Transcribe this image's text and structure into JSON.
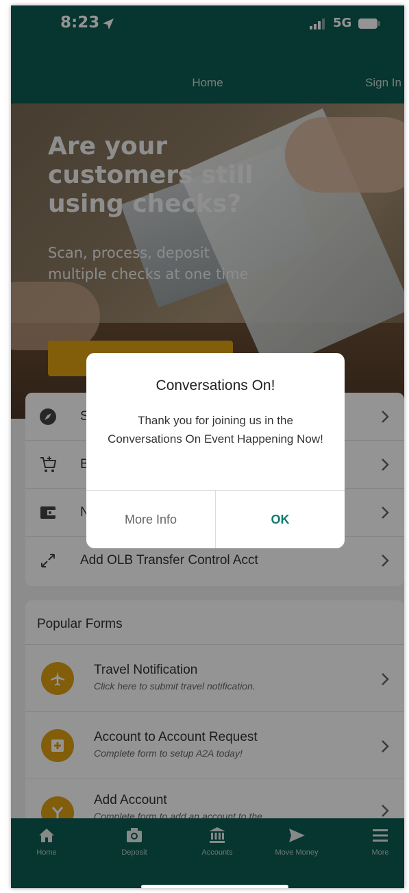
{
  "status_bar": {
    "time": "8:23",
    "network": "5G"
  },
  "header": {
    "title": "Home",
    "sign_in": "Sign In"
  },
  "hero": {
    "title": "Are your customers still using checks?",
    "subtitle": "Scan, process, deposit multiple checks at one time",
    "cta_label": ""
  },
  "quick_links": [
    {
      "icon": "compass-icon",
      "label": "S"
    },
    {
      "icon": "cart-icon",
      "label": "B"
    },
    {
      "icon": "wallet-icon",
      "label": "N"
    },
    {
      "icon": "transfer-arrows-icon",
      "label": "Add OLB Transfer Control Acct"
    }
  ],
  "popular_forms": {
    "title": "Popular Forms",
    "items": [
      {
        "icon": "airplane-icon",
        "name": "Travel Notification",
        "desc": "Click here to submit travel notification."
      },
      {
        "icon": "deposit-box-icon",
        "name": "Account to Account Request",
        "desc": "Complete form to setup A2A today!"
      },
      {
        "icon": "fork-icon",
        "name": "Add Account",
        "desc": "Complete form to add an account to the"
      }
    ]
  },
  "tabbar": [
    {
      "icon": "home-icon",
      "label": "Home"
    },
    {
      "icon": "camera-icon",
      "label": "Deposit"
    },
    {
      "icon": "bank-icon",
      "label": "Accounts"
    },
    {
      "icon": "send-icon",
      "label": "Move Money"
    },
    {
      "icon": "menu-icon",
      "label": "More"
    }
  ],
  "dialog": {
    "title": "Conversations On!",
    "message": "Thank you for joining us in the Conversations On Event Happening Now!",
    "secondary_label": "More Info",
    "primary_label": "OK"
  },
  "colors": {
    "brand": "#0d5c52",
    "accent": "#e0a112",
    "ok_button": "#0e7a6c"
  }
}
